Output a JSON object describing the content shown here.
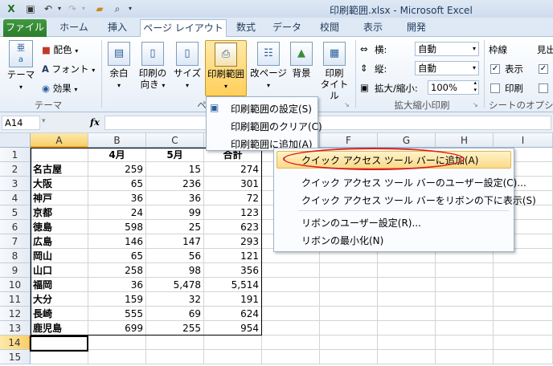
{
  "window": {
    "title": "印刷範囲.xlsx - Microsoft Excel"
  },
  "tabs": [
    {
      "label": "ファイル"
    },
    {
      "label": "ホーム"
    },
    {
      "label": "挿入"
    },
    {
      "label": "ページ レイアウト"
    },
    {
      "label": "数式"
    },
    {
      "label": "データ"
    },
    {
      "label": "校閲"
    },
    {
      "label": "表示"
    },
    {
      "label": "開発"
    }
  ],
  "ribbon": {
    "theme": {
      "main": "テーマ",
      "colors": "配色",
      "fonts": "フォント",
      "effects": "効果",
      "group": "テーマ"
    },
    "page_setup": {
      "margins": "余白",
      "orientation_l1": "印刷の",
      "orientation_l2": "向き",
      "size": "サイズ",
      "print_area": "印刷範囲",
      "breaks": "改ページ",
      "background": "背景",
      "print_titles_l1": "印刷",
      "print_titles_l2": "タイトル",
      "group_partial": "ペ"
    },
    "scale": {
      "width_label": "横:",
      "width_value": "自動",
      "height_label": "縦:",
      "height_value": "自動",
      "scale_label": "拡大/縮小:",
      "scale_value": "100%",
      "group": "拡大縮小印刷"
    },
    "sheet_options": {
      "gridlines": "枠線",
      "view": "表示",
      "print": "印刷",
      "headings_partial": "見出",
      "group": "シートのオプション"
    }
  },
  "formula_bar": {
    "name_box": "A14",
    "fx": "fx",
    "formula": ""
  },
  "columns": [
    "A",
    "B",
    "C",
    "D",
    "E",
    "F",
    "G",
    "H",
    "I"
  ],
  "rows": [
    {
      "n": "1",
      "a": "",
      "b": "4月",
      "c": "5月",
      "d": "合計"
    },
    {
      "n": "2",
      "a": "名古屋",
      "b": "259",
      "c": "15",
      "d": "274"
    },
    {
      "n": "3",
      "a": "大阪",
      "b": "65",
      "c": "236",
      "d": "301"
    },
    {
      "n": "4",
      "a": "神戸",
      "b": "36",
      "c": "36",
      "d": "72"
    },
    {
      "n": "5",
      "a": "京都",
      "b": "24",
      "c": "99",
      "d": "123"
    },
    {
      "n": "6",
      "a": "徳島",
      "b": "598",
      "c": "25",
      "d": "623"
    },
    {
      "n": "7",
      "a": "広島",
      "b": "146",
      "c": "147",
      "d": "293"
    },
    {
      "n": "8",
      "a": "岡山",
      "b": "65",
      "c": "56",
      "d": "121"
    },
    {
      "n": "9",
      "a": "山口",
      "b": "258",
      "c": "98",
      "d": "356"
    },
    {
      "n": "10",
      "a": "福岡",
      "b": "36",
      "c": "5,478",
      "d": "5,514"
    },
    {
      "n": "11",
      "a": "大分",
      "b": "159",
      "c": "32",
      "d": "191"
    },
    {
      "n": "12",
      "a": "長崎",
      "b": "555",
      "c": "69",
      "d": "624"
    },
    {
      "n": "13",
      "a": "鹿児島",
      "b": "699",
      "c": "255",
      "d": "954"
    },
    {
      "n": "14",
      "a": "",
      "b": "",
      "c": "",
      "d": ""
    },
    {
      "n": "15",
      "a": "",
      "b": "",
      "c": "",
      "d": ""
    }
  ],
  "print_area_menu": {
    "set": "印刷範囲の設定(S)",
    "clear": "印刷範囲のクリア(C)",
    "add": "印刷範囲に追加(A)"
  },
  "context_menu": {
    "add_qat": "クイック アクセス ツール バーに追加(A)",
    "customize_qat": "クイック アクセス ツール バーのユーザー設定(C)...",
    "show_below": "クイック アクセス ツール バーをリボンの下に表示(S)",
    "customize_ribbon": "リボンのユーザー設定(R)...",
    "minimize_ribbon": "リボンの最小化(N)"
  },
  "colors": {
    "file_tab": "#2c7b2c",
    "highlight_ring": "#d9201f",
    "selected_menu_item": "#fbe29a"
  }
}
